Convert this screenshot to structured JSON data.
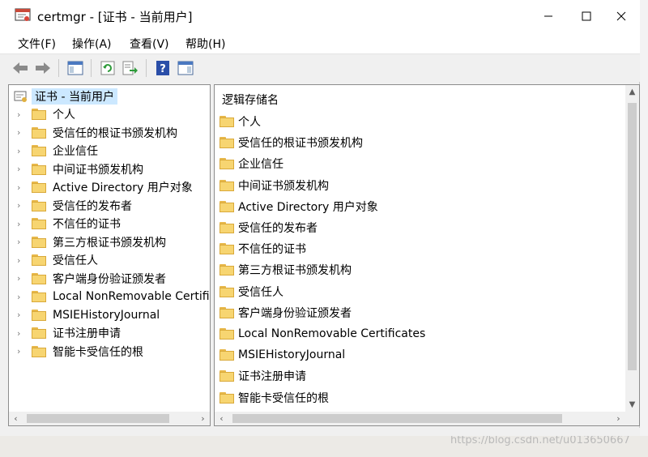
{
  "window": {
    "title": "certmgr - [证书 - 当前用户]"
  },
  "menu": [
    "文件(F)",
    "操作(A)",
    "查看(V)",
    "帮助(H)"
  ],
  "toolbar": {
    "icons": [
      "back-arrow-icon",
      "forward-arrow-icon",
      "show-hide-console-tree-icon",
      "refresh-icon",
      "export-list-icon",
      "help-icon",
      "show-hide-action-pane-icon"
    ]
  },
  "tree": {
    "root": "证书 - 当前用户",
    "items": [
      "个人",
      "受信任的根证书颁发机构",
      "企业信任",
      "中间证书颁发机构",
      "Active Directory 用户对象",
      "受信任的发布者",
      "不信任的证书",
      "第三方根证书颁发机构",
      "受信任人",
      "客户端身份验证颁发者",
      "Local NonRemovable Certifi",
      "MSIEHistoryJournal",
      "证书注册申请",
      "智能卡受信任的根"
    ]
  },
  "list": {
    "header": "逻辑存储名",
    "items": [
      "个人",
      "受信任的根证书颁发机构",
      "企业信任",
      "中间证书颁发机构",
      "Active Directory 用户对象",
      "受信任的发布者",
      "不信任的证书",
      "第三方根证书颁发机构",
      "受信任人",
      "客户端身份验证颁发者",
      "Local NonRemovable Certificates",
      "MSIEHistoryJournal",
      "证书注册申请",
      "智能卡受信任的根"
    ]
  },
  "background": {
    "watermark": "https://blog.csdn.net/u013650667"
  }
}
